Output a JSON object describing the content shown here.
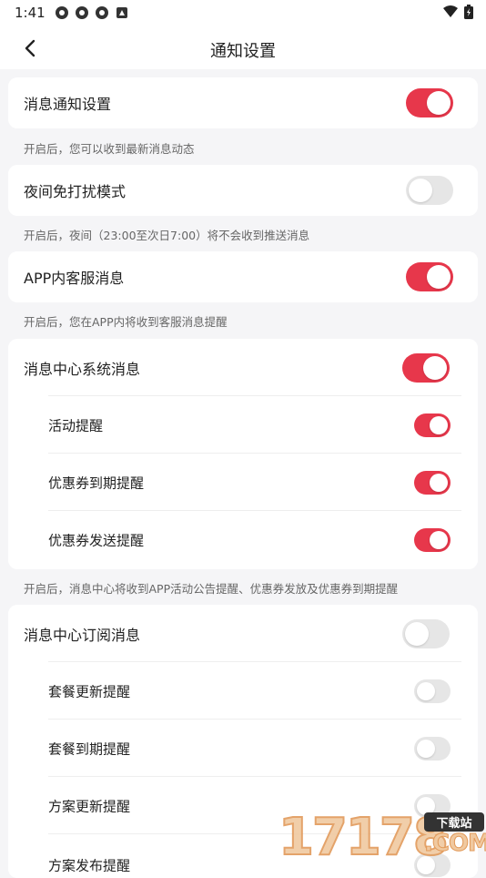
{
  "status_bar": {
    "time": "1:41",
    "left_icons": [
      "app-icon",
      "app-icon",
      "app-icon",
      "notification-icon"
    ],
    "right_icons": [
      "wifi-icon",
      "battery-icon"
    ]
  },
  "header": {
    "title": "通知设置"
  },
  "sections": [
    {
      "label": "消息通知设置",
      "on": true,
      "hint": "开启后，您可以收到最新消息动态"
    },
    {
      "label": "夜间免打扰模式",
      "on": false,
      "hint": "开启后，夜间（23:00至次日7:00）将不会收到推送消息"
    },
    {
      "label": "APP内客服消息",
      "on": true,
      "hint": "开启后，您在APP内将收到客服消息提醒"
    },
    {
      "label": "消息中心系统消息",
      "on": true,
      "items": [
        {
          "label": "活动提醒",
          "on": true
        },
        {
          "label": "优惠券到期提醒",
          "on": true
        },
        {
          "label": "优惠券发送提醒",
          "on": true
        }
      ],
      "hint": "开启后，消息中心将收到APP活动公告提醒、优惠券发放及优惠券到期提醒"
    },
    {
      "label": "消息中心订阅消息",
      "on": false,
      "items": [
        {
          "label": "套餐更新提醒",
          "on": false
        },
        {
          "label": "套餐到期提醒",
          "on": false
        },
        {
          "label": "方案更新提醒",
          "on": false
        },
        {
          "label": "方案发布提醒",
          "on": false
        }
      ]
    }
  ],
  "watermark": {
    "digits": "17178",
    "badge": "下载站",
    "domain": ".COM"
  },
  "colors": {
    "accent": "#e7374b",
    "toggle_off": "#e6e6e6",
    "background": "#f5f5f7"
  }
}
